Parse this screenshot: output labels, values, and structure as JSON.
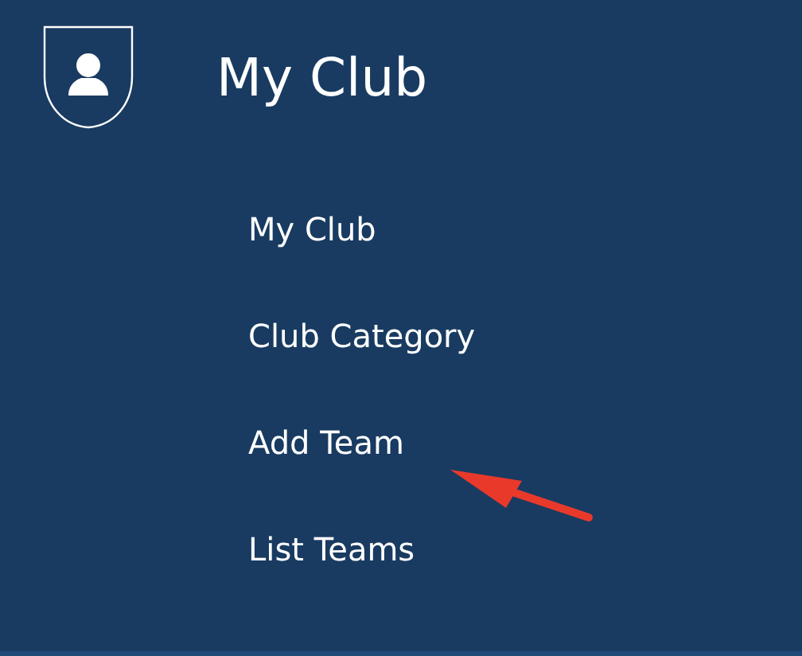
{
  "header": {
    "title": "My Club"
  },
  "menu": [
    {
      "label": "My Club"
    },
    {
      "label": "Club Category"
    },
    {
      "label": "Add Team"
    },
    {
      "label": "List Teams"
    }
  ]
}
